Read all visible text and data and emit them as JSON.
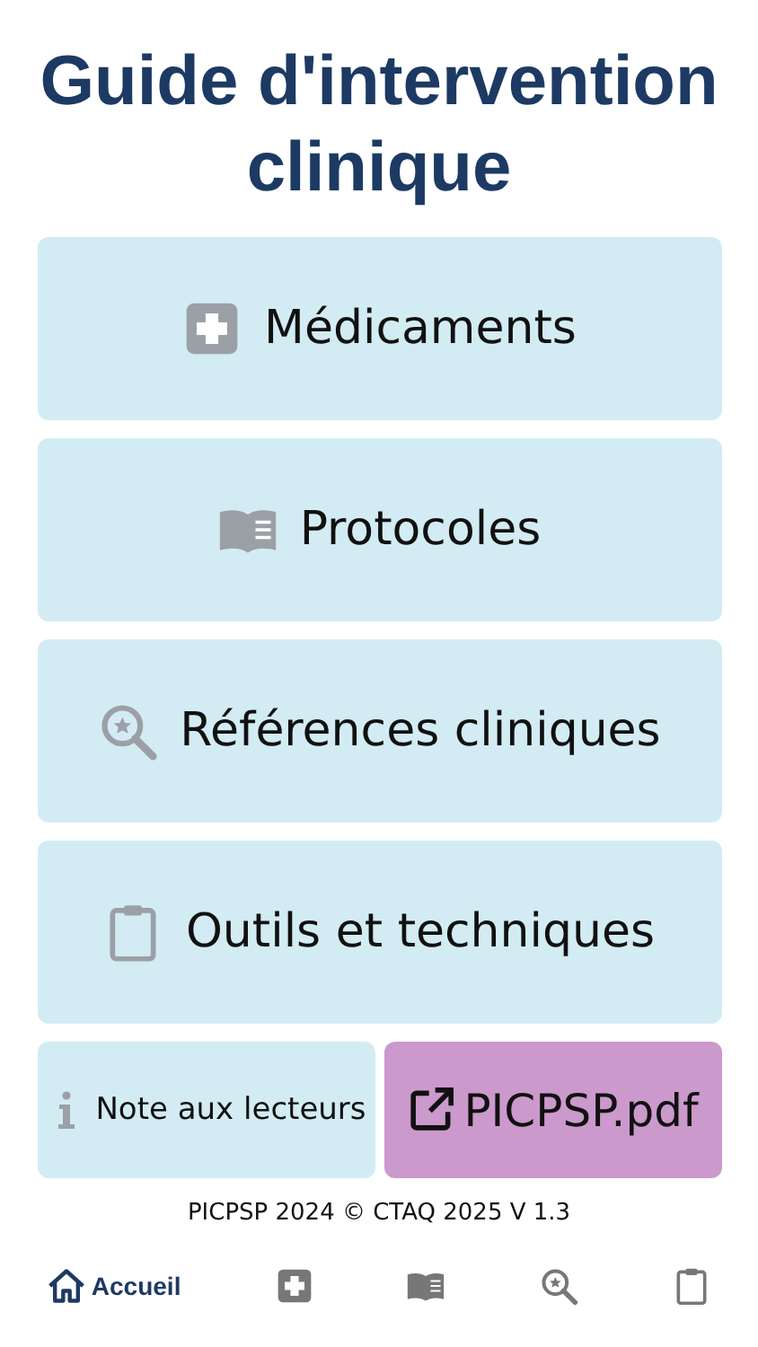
{
  "title": "Guide d'intervention clinique",
  "menu": [
    {
      "kind": "plus",
      "label": "Médicaments"
    },
    {
      "kind": "book",
      "label": "Protocoles"
    },
    {
      "kind": "search",
      "label": "Références cliniques"
    },
    {
      "kind": "clipboard",
      "label": "Outils et techniques"
    }
  ],
  "links": [
    {
      "kind": "info",
      "label": "Note aux lecteurs",
      "color": "#d3ecf3"
    },
    {
      "kind": "external",
      "label": "PICPSP.pdf",
      "color": "#cc99cc"
    }
  ],
  "footer": "PICPSP 2024 © CTAQ 2025 V 1.3",
  "tabs": [
    {
      "kind": "home",
      "label": "Accueil",
      "selected": true
    },
    {
      "kind": "plus",
      "selected": false
    },
    {
      "kind": "book",
      "selected": false
    },
    {
      "kind": "search",
      "selected": false
    },
    {
      "kind": "clipboard",
      "selected": false
    }
  ]
}
